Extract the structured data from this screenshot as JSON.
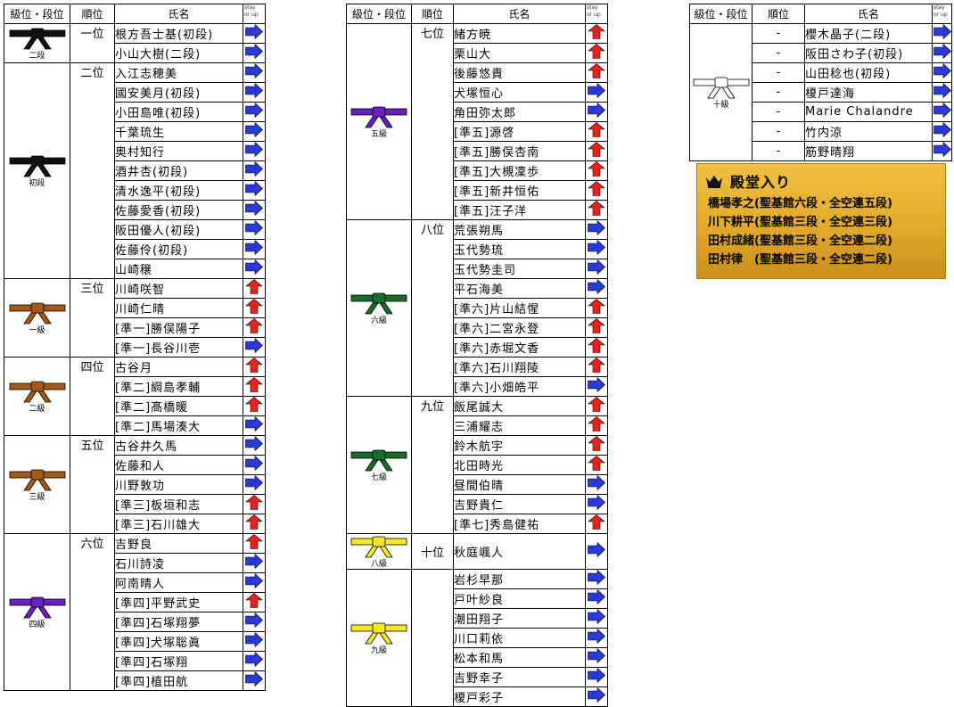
{
  "headers": {
    "grade": "級位・段位",
    "rank": "順位",
    "name": "氏名",
    "stay1": "stay",
    "stay2": "or up"
  },
  "colors": {
    "up": "#e8231c",
    "stay": "#2b3ad6",
    "black": "#111111",
    "brown": "#a45a14",
    "purple": "#6a1fbf",
    "green": "#1b6b2c",
    "yellow": "#f3e82a",
    "white": "#ffffff"
  },
  "tables": [
    {
      "groups": [
        {
          "belt": "black",
          "label": "二段",
          "ranks": [
            {
              "rank": "一位",
              "members": [
                {
                  "name": "根方吾士基(初段)",
                  "arrow": "stay"
                },
                {
                  "name": "小山大樹(二段)",
                  "arrow": "stay"
                }
              ]
            }
          ]
        },
        {
          "belt": "black",
          "label": "初段",
          "ranks": [
            {
              "rank": "二位",
              "members": [
                {
                  "name": "入江志穂美",
                  "arrow": "stay"
                },
                {
                  "name": "國安美月(初段)",
                  "arrow": "stay"
                },
                {
                  "name": "小田島唯(初段)",
                  "arrow": "stay"
                },
                {
                  "name": "千葉琉生",
                  "arrow": "stay"
                },
                {
                  "name": "奥村知行",
                  "arrow": "stay"
                },
                {
                  "name": "酒井杏(初段)",
                  "arrow": "stay"
                },
                {
                  "name": "清水逸平(初段)",
                  "arrow": "stay"
                },
                {
                  "name": "佐藤愛香(初段)",
                  "arrow": "stay"
                },
                {
                  "name": "阪田優人(初段)",
                  "arrow": "stay"
                },
                {
                  "name": "佐藤伶(初段)",
                  "arrow": "stay"
                },
                {
                  "name": "山崎穣",
                  "arrow": "stay"
                }
              ]
            }
          ]
        },
        {
          "belt": "brown",
          "label": "一級",
          "ranks": [
            {
              "rank": "三位",
              "members": [
                {
                  "name": "川崎咲智",
                  "arrow": "up"
                },
                {
                  "name": "川崎仁晴",
                  "arrow": "up"
                },
                {
                  "name": "[準一]勝俣陽子",
                  "arrow": "up"
                },
                {
                  "name": "[準一]長谷川壱",
                  "arrow": "stay"
                }
              ]
            }
          ]
        },
        {
          "belt": "brown",
          "label": "二級",
          "ranks": [
            {
              "rank": "四位",
              "members": [
                {
                  "name": "古谷月",
                  "arrow": "up"
                },
                {
                  "name": "[準二]綱島孝輔",
                  "arrow": "up"
                },
                {
                  "name": "[準二]髙橋暖",
                  "arrow": "up"
                },
                {
                  "name": "[準二]馬場湊大",
                  "arrow": "stay"
                }
              ]
            }
          ]
        },
        {
          "belt": "brown",
          "label": "三級",
          "ranks": [
            {
              "rank": "五位",
              "members": [
                {
                  "name": "古谷井久馬",
                  "arrow": "stay"
                },
                {
                  "name": "佐藤和人",
                  "arrow": "stay"
                },
                {
                  "name": "川野敦功",
                  "arrow": "stay"
                },
                {
                  "name": "[準三]板垣和志",
                  "arrow": "up"
                },
                {
                  "name": "[準三]石川雄大",
                  "arrow": "up"
                }
              ]
            }
          ]
        },
        {
          "belt": "purple",
          "label": "四級",
          "ranks": [
            {
              "rank": "六位",
              "members": [
                {
                  "name": "吉野良",
                  "arrow": "up"
                },
                {
                  "name": "石川詩凌",
                  "arrow": "stay"
                },
                {
                  "name": "阿南晴人",
                  "arrow": "stay"
                },
                {
                  "name": "[準四]平野武史",
                  "arrow": "up"
                },
                {
                  "name": "[準四]石塚翔夢",
                  "arrow": "stay"
                },
                {
                  "name": "[準四]犬塚聡眞",
                  "arrow": "stay"
                },
                {
                  "name": "[準四]石塚翔",
                  "arrow": "stay"
                },
                {
                  "name": "[準四]植田航",
                  "arrow": "stay"
                }
              ]
            }
          ]
        }
      ]
    },
    {
      "groups": [
        {
          "belt": "purple",
          "label": "五級",
          "ranks": [
            {
              "rank": "七位",
              "members": [
                {
                  "name": "緒方暁",
                  "arrow": "up"
                },
                {
                  "name": "栗山大",
                  "arrow": "up"
                },
                {
                  "name": "後藤悠貴",
                  "arrow": "up"
                },
                {
                  "name": "犬塚恒心",
                  "arrow": "stay"
                },
                {
                  "name": "角田弥太郎",
                  "arrow": "stay"
                },
                {
                  "name": "[準五]源啓",
                  "arrow": "up"
                },
                {
                  "name": "[準五]勝俣杏南",
                  "arrow": "up"
                },
                {
                  "name": "[準五]大槻凜歩",
                  "arrow": "up"
                },
                {
                  "name": "[準五]新井恒佑",
                  "arrow": "up"
                },
                {
                  "name": "[準五]汪子洋",
                  "arrow": "up"
                }
              ]
            }
          ]
        },
        {
          "belt": "green",
          "label": "六級",
          "ranks": [
            {
              "rank": "八位",
              "members": [
                {
                  "name": "荒張朔馬",
                  "arrow": "stay"
                },
                {
                  "name": "玉代勢琉",
                  "arrow": "stay"
                },
                {
                  "name": "玉代勢圭司",
                  "arrow": "stay"
                },
                {
                  "name": "平石海美",
                  "arrow": "stay"
                },
                {
                  "name": "[準六]片山結惺",
                  "arrow": "up"
                },
                {
                  "name": "[準六]二宮永登",
                  "arrow": "up"
                },
                {
                  "name": "[準六]赤堀文香",
                  "arrow": "up"
                },
                {
                  "name": "[準六]石川翔陵",
                  "arrow": "up"
                },
                {
                  "name": "[準六]小畑皓平",
                  "arrow": "stay"
                }
              ]
            }
          ]
        },
        {
          "belt": "green",
          "label": "七級",
          "ranks": [
            {
              "rank": "九位",
              "members": [
                {
                  "name": "飯尾誠大",
                  "arrow": "up"
                },
                {
                  "name": "三浦耀志",
                  "arrow": "up"
                },
                {
                  "name": "鈴木航宇",
                  "arrow": "up"
                },
                {
                  "name": "北田時光",
                  "arrow": "up"
                },
                {
                  "name": "昼間伯晴",
                  "arrow": "stay"
                },
                {
                  "name": "吉野貴仁",
                  "arrow": "stay"
                },
                {
                  "name": "[準七]秀島健祐",
                  "arrow": "up"
                }
              ]
            }
          ]
        },
        {
          "belt": "yellow",
          "label": "八級",
          "ranks": [
            {
              "rank": "十位",
              "members": [
                {
                  "name": "秋庭颯人",
                  "arrow": "stay"
                }
              ]
            }
          ]
        },
        {
          "belt": "yellow",
          "label": "九級",
          "ranks": [
            {
              "rank": "",
              "members": [
                {
                  "name": "岩杉早那",
                  "arrow": "stay"
                },
                {
                  "name": "戸叶紗良",
                  "arrow": "stay"
                },
                {
                  "name": "潮田翔子",
                  "arrow": "stay"
                },
                {
                  "name": "川口莉依",
                  "arrow": "stay"
                },
                {
                  "name": "松本和馬",
                  "arrow": "stay"
                },
                {
                  "name": "吉野幸子",
                  "arrow": "stay"
                },
                {
                  "name": "榎戸彩子",
                  "arrow": "stay"
                }
              ]
            }
          ]
        }
      ]
    },
    {
      "groups": [
        {
          "belt": "white",
          "label": "十級",
          "ranks": [
            {
              "rank": "-",
              "members": [
                {
                  "name": "櫻木晶子(二段)",
                  "arrow": "stay"
                }
              ]
            },
            {
              "rank": "-",
              "members": [
                {
                  "name": "阪田さわ子(初段)",
                  "arrow": "stay"
                }
              ]
            },
            {
              "rank": "-",
              "members": [
                {
                  "name": "山田稔也(初段)",
                  "arrow": "stay"
                }
              ]
            },
            {
              "rank": "-",
              "members": [
                {
                  "name": "榎戸達海",
                  "arrow": "stay"
                }
              ]
            },
            {
              "rank": "-",
              "members": [
                {
                  "name": "Marie Chalandre",
                  "arrow": "stay"
                }
              ]
            },
            {
              "rank": "-",
              "members": [
                {
                  "name": "竹内涼",
                  "arrow": "stay"
                }
              ]
            },
            {
              "rank": "-",
              "members": [
                {
                  "name": "筋野晴翔",
                  "arrow": "stay"
                }
              ]
            }
          ]
        }
      ]
    }
  ],
  "hall_of_fame": {
    "title": "殿堂入り",
    "icon": "crown-icon",
    "members": [
      "橋場孝之(聖基館六段・全空連五段)",
      "川下耕平(聖基館三段・全空連三段)",
      "田村成緒(聖基館三段・全空連二段)",
      "田村律　(聖基館三段・全空連二段)"
    ]
  }
}
